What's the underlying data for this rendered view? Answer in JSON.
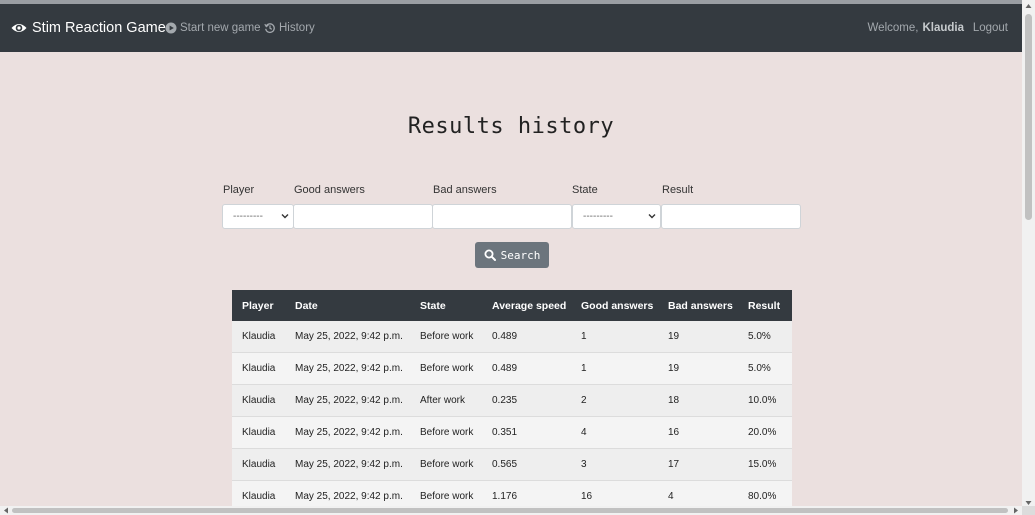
{
  "navbar": {
    "brand": "Stim Reaction Game",
    "start_new_game": "Start new game",
    "history": "History",
    "welcome_prefix": "Welcome,",
    "username": "Klaudia",
    "logout": "Logout"
  },
  "page": {
    "title": "Results history"
  },
  "filters": {
    "player_label": "Player",
    "player_value": "---------",
    "good_label": "Good answers",
    "good_value": "",
    "bad_label": "Bad answers",
    "bad_value": "",
    "state_label": "State",
    "state_value": "---------",
    "result_label": "Result",
    "result_value": "",
    "search_label": "Search"
  },
  "table": {
    "headers": [
      "Player",
      "Date",
      "State",
      "Average speed",
      "Good answers",
      "Bad answers",
      "Result"
    ],
    "rows": [
      [
        "Klaudia",
        "May 25, 2022, 9:42 p.m.",
        "Before work",
        "0.489",
        "1",
        "19",
        "5.0%"
      ],
      [
        "Klaudia",
        "May 25, 2022, 9:42 p.m.",
        "Before work",
        "0.489",
        "1",
        "19",
        "5.0%"
      ],
      [
        "Klaudia",
        "May 25, 2022, 9:42 p.m.",
        "After work",
        "0.235",
        "2",
        "18",
        "10.0%"
      ],
      [
        "Klaudia",
        "May 25, 2022, 9:42 p.m.",
        "Before work",
        "0.351",
        "4",
        "16",
        "20.0%"
      ],
      [
        "Klaudia",
        "May 25, 2022, 9:42 p.m.",
        "Before work",
        "0.565",
        "3",
        "17",
        "15.0%"
      ],
      [
        "Klaudia",
        "May 25, 2022, 9:42 p.m.",
        "Before work",
        "1.176",
        "16",
        "4",
        "80.0%"
      ]
    ]
  },
  "icons": {
    "brand": "eye-icon",
    "start_new_game": "play-circle-icon",
    "history": "history-icon",
    "search": "search-icon",
    "select": "chevron-down-icon"
  },
  "colors": {
    "navbar": "#343a40",
    "background": "#ebe0df",
    "search_button": "#6c757d",
    "table_header": "#343a40"
  }
}
